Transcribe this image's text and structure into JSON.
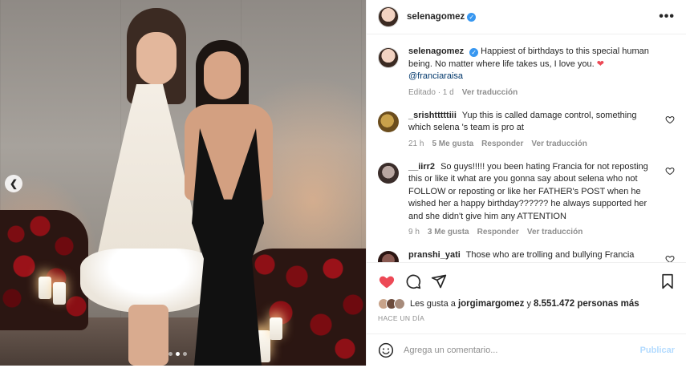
{
  "post": {
    "author": "selenagomez",
    "verified": true,
    "caption_text": "Happiest of birthdays to this special human being. No matter where life takes us, I love you.",
    "caption_heart": "❤",
    "caption_mention": "@franciaraisa",
    "caption_meta_edited": "Editado · 1 d",
    "caption_meta_translate": "Ver traducción"
  },
  "comments": [
    {
      "username": "_srishtttttiii",
      "text": "Yup this is called damage control, something which selena 's team is pro at",
      "time": "21 h",
      "likes": "5 Me gusta",
      "reply": "Responder",
      "translate": "Ver traducción"
    },
    {
      "username": "__iirr2",
      "text": "So guys!!!!! you been hating Francia for not reposting this or like it what are you gonna say about selena who not FOLLOW or reposting or like her FATHER's POST when he wished her a happy birthday?????? he always supported her and she didn't give him any ATTENTION",
      "time": "9 h",
      "likes": "3 Me gusta",
      "reply": "Responder",
      "translate": "Ver traducción"
    },
    {
      "username": "pranshi_yati",
      "text": "Those who are trolling and bullying Francia should be ashamed of themselves!",
      "time": "",
      "likes": "",
      "reply": "",
      "translate": ""
    }
  ],
  "likes": {
    "prefix": "Les gusta a",
    "user": "jorgimargomez",
    "connector": "y",
    "count": "8.551.472 personas más"
  },
  "date_label": "HACE UN DÍA",
  "comment_input": {
    "placeholder": "Agrega un comentario...",
    "publish_label": "Publicar"
  },
  "icons": {
    "like": "heart-filled-icon",
    "comment": "comment-icon",
    "share": "send-icon",
    "save": "bookmark-icon",
    "emoji": "emoji-icon",
    "more": "more-options-icon",
    "prev": "chevron-left-icon"
  },
  "colors": {
    "like_red": "#ed4956",
    "verified_blue": "#3897f0",
    "link_blue": "#00376b",
    "publish_disabled": "#b3dbff",
    "muted": "#8e8e8e"
  },
  "carousel": {
    "total_slides": 3,
    "active_slide": 2
  }
}
